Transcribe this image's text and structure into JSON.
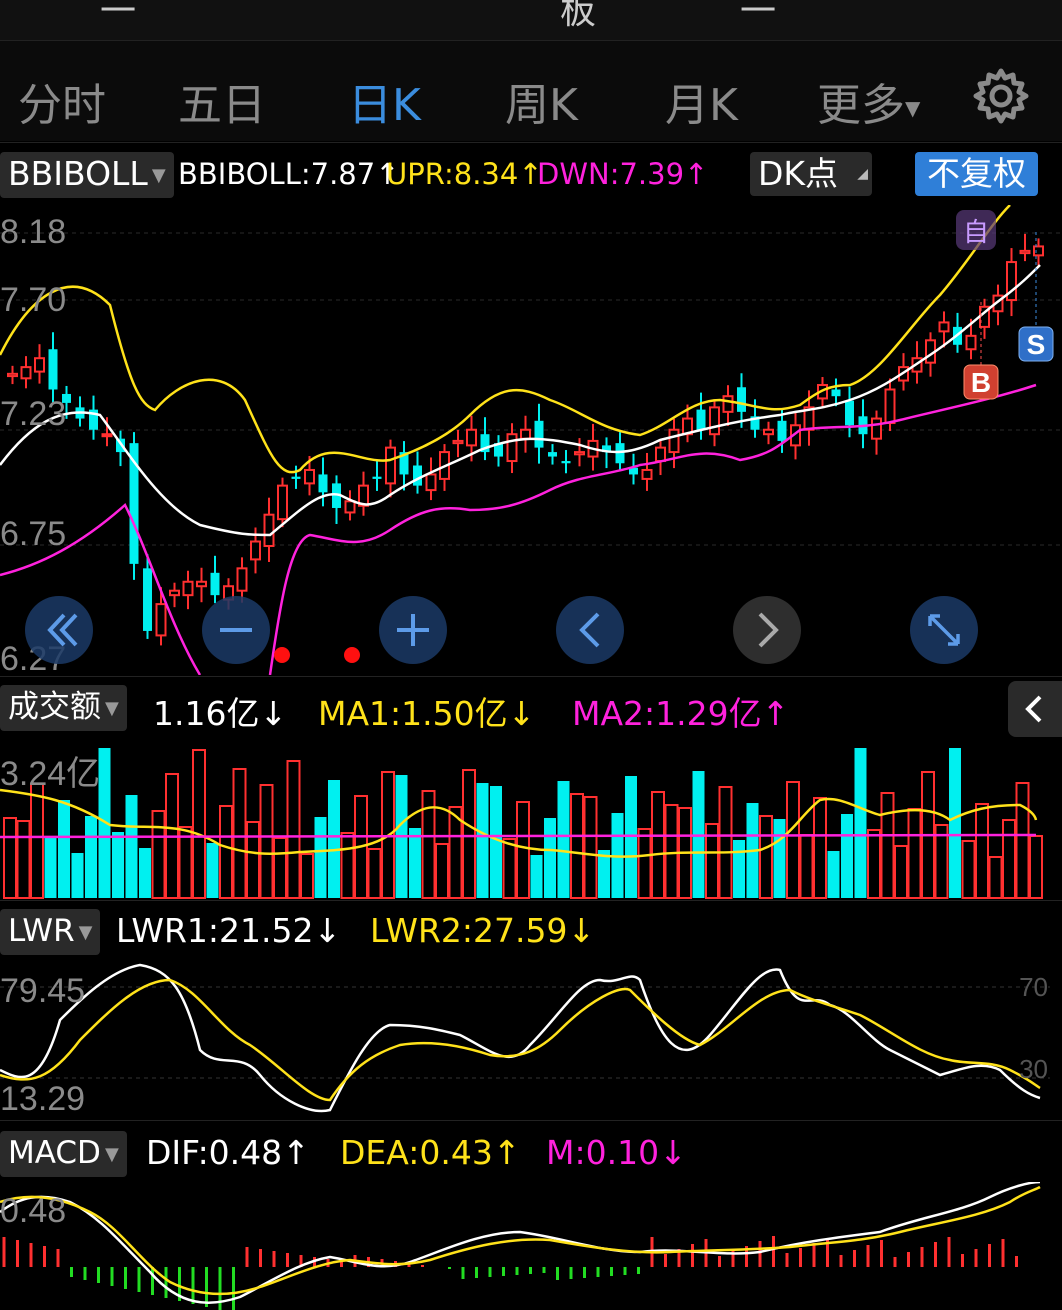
{
  "top": {
    "fragments": [
      "一",
      "板",
      "一"
    ]
  },
  "tabs": [
    {
      "label": "分时"
    },
    {
      "label": "五日"
    },
    {
      "label": "日K"
    },
    {
      "label": "周K"
    },
    {
      "label": "月K"
    },
    {
      "label": "更多"
    }
  ],
  "main_indicator": {
    "selector": "BBIBOLL",
    "bbiboll": "BBIBOLL:7.87↑",
    "upr": "UPR:8.34↑",
    "dwn": "DWN:7.39↑",
    "dk_button": "DK点",
    "fq_button": "不复权",
    "y_labels": [
      "8.18",
      "7.70",
      "7.23",
      "6.75",
      "6.27"
    ],
    "marker_b": "B",
    "marker_s": "S",
    "marker_self": "自"
  },
  "volume": {
    "selector": "成交额",
    "value": "1.16亿↓",
    "ma1": "MA1:1.50亿↓",
    "ma2": "MA2:1.29亿↑",
    "y_label": "3.24亿"
  },
  "lwr": {
    "selector": "LWR",
    "lwr1": "LWR1:21.52↓",
    "lwr2": "LWR2:27.59↓",
    "y_labels": [
      "79.45",
      "13.29"
    ],
    "ref_labels": [
      "70",
      "30"
    ]
  },
  "macd": {
    "selector": "MACD",
    "dif": "DIF:0.48↑",
    "dea": "DEA:0.43↑",
    "m": "M:0.10↓",
    "y_label": "0.48"
  },
  "colors": {
    "up": "#ff3030",
    "down": "#00f0f0",
    "ma1": "#ffe21a",
    "ma2": "#ff22dd",
    "accent": "#3b8dde"
  },
  "chart_data": {
    "type": "candlestick",
    "price_axis": [
      6.27,
      8.18
    ],
    "closes": [
      7.55,
      7.58,
      7.62,
      7.48,
      7.42,
      7.35,
      7.3,
      7.28,
      7.2,
      6.7,
      6.4,
      6.52,
      6.58,
      6.62,
      6.62,
      6.56,
      6.6,
      6.68,
      6.8,
      6.92,
      7.05,
      7.08,
      7.12,
      7.02,
      6.95,
      6.98,
      7.05,
      7.08,
      7.22,
      7.1,
      7.05,
      7.1,
      7.2,
      7.25,
      7.3,
      7.2,
      7.18,
      7.28,
      7.3,
      7.22,
      7.18,
      7.15,
      7.2,
      7.25,
      7.2,
      7.15,
      7.1,
      7.12,
      7.22,
      7.3,
      7.35,
      7.3,
      7.4,
      7.45,
      7.38,
      7.3,
      7.3,
      7.25,
      7.32,
      7.4,
      7.5,
      7.45,
      7.32,
      7.28,
      7.35,
      7.48,
      7.58,
      7.62,
      7.7,
      7.78,
      7.68,
      7.72,
      7.85,
      7.9,
      8.05,
      8.1,
      8.12
    ]
  }
}
